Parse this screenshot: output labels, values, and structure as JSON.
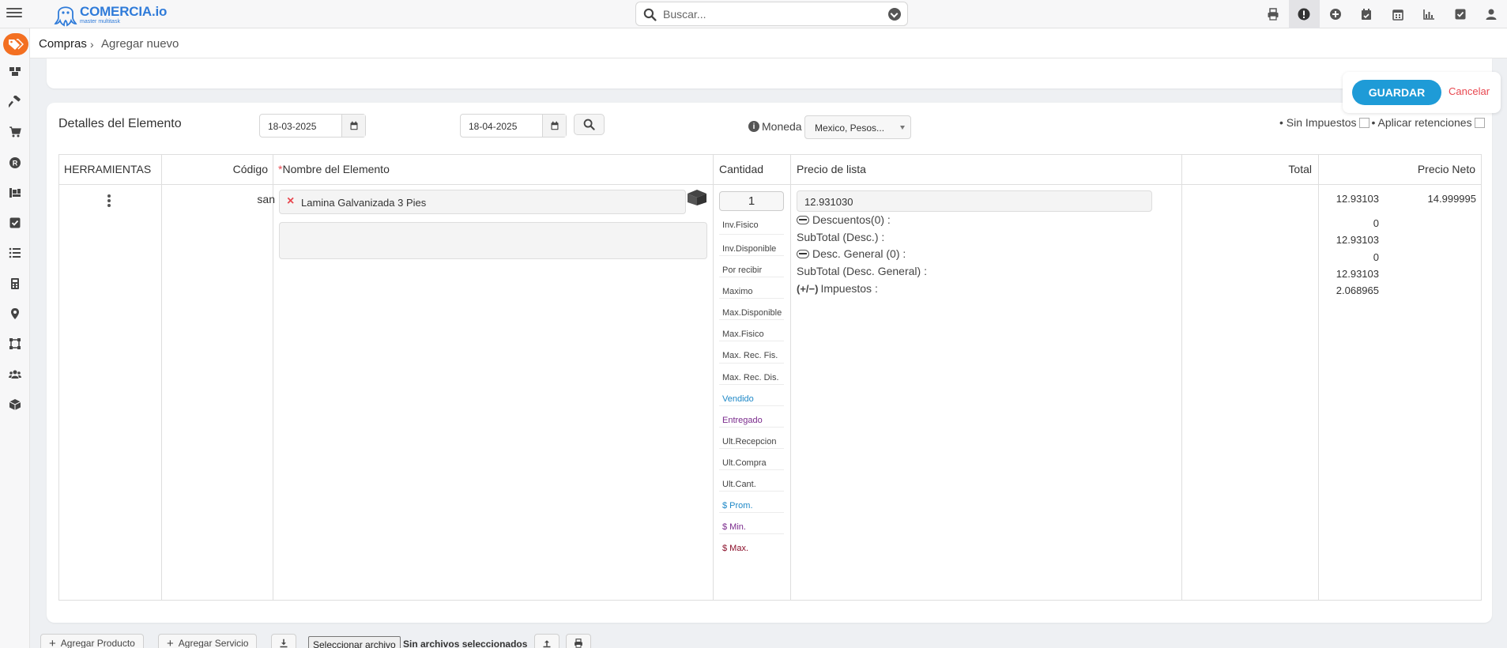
{
  "app": {
    "name": "COMERCIA.io",
    "tagline": "master multitask"
  },
  "search": {
    "placeholder": "Buscar..."
  },
  "topbar": {
    "icons": [
      "printer-icon",
      "alert-icon",
      "add-circle-icon",
      "calendar-check-icon",
      "calendar-icon",
      "bar-chart-icon",
      "check-square-icon",
      "user-icon"
    ],
    "active_icon": "alert-icon"
  },
  "sidebar": {
    "items": [
      "tags-icon",
      "boxes-icon",
      "hammer-icon",
      "cart-icon",
      "registered-icon",
      "dolly-icon",
      "check-square-icon",
      "list-icon",
      "calculator-icon",
      "map-marker-icon",
      "vector-square-icon",
      "users-icon",
      "cube-icon"
    ]
  },
  "breadcrumb": {
    "root": "Compras",
    "current": "Agregar nuevo"
  },
  "actions": {
    "save": "GUARDAR",
    "cancel": "Cancelar"
  },
  "details": {
    "title": "Detalles del Elemento",
    "date_from": "18-03-2025",
    "date_to": "18-04-2025",
    "currency_label": "Moneda",
    "currency_value": "Mexico, Pesos...",
    "sin_impuestos": "• Sin Impuestos",
    "aplicar_retenciones": "• Aplicar retenciones"
  },
  "table": {
    "headers": {
      "herramientas": "HERRAMIENTAS",
      "codigo": "Código",
      "nombre": "Nombre del Elemento",
      "cantidad": "Cantidad",
      "precio": "Precio de lista",
      "total": "Total",
      "neto": "Precio Neto"
    },
    "row": {
      "codigo": "san",
      "nombre": "Lamina Galvanizada 3 Pies",
      "cantidad": "1",
      "precio_lista": "12.931030",
      "labels": {
        "descuentos": "Descuentos(0) :",
        "subtotal_desc": "SubTotal (Desc.) :",
        "desc_general": "Desc. General (0) :",
        "subtotal_general": "SubTotal (Desc. General) :",
        "impuestos": "Impuestos :",
        "impuestos_prefix": "(+/−)"
      },
      "totals": {
        "total": "12.93103",
        "descuentos": "0",
        "subtotal_desc": "12.93103",
        "desc_general": "0",
        "subtotal_general": "12.93103",
        "impuestos": "2.068965"
      },
      "precio_neto": "14.999995"
    },
    "stats": [
      {
        "label": "Inv.Fisico",
        "color": "#444444"
      },
      {
        "label": "Inv.Disponible",
        "color": "#444444"
      },
      {
        "label": "Por recibir",
        "color": "#444444"
      },
      {
        "label": "Maximo",
        "color": "#444444"
      },
      {
        "label": "Max.Disponible",
        "color": "#444444"
      },
      {
        "label": "Max.Fisico",
        "color": "#444444"
      },
      {
        "label": "Max. Rec. Fis.",
        "color": "#444444"
      },
      {
        "label": "Max. Rec. Dis.",
        "color": "#444444"
      },
      {
        "label": "Vendido",
        "color": "#1e88c7"
      },
      {
        "label": "Entregado",
        "color": "#7a2a8c"
      },
      {
        "label": "Ult.Recepcion",
        "color": "#444444"
      },
      {
        "label": "Ult.Compra",
        "color": "#444444"
      },
      {
        "label": "Ult.Cant.",
        "color": "#444444"
      },
      {
        "label": "$ Prom.",
        "color": "#1e88c7"
      },
      {
        "label": "$ Min.",
        "color": "#7a2a8c"
      },
      {
        "label": "$ Max.",
        "color": "#8b0f2a"
      }
    ]
  },
  "bottom": {
    "add_product": "Agregar Producto",
    "add_service": "Agregar Servicio",
    "file_button": "Seleccionar archivo",
    "file_none": "Sin archivos seleccionados"
  },
  "colors": {
    "accent": "#1e9bd7",
    "brand": "#2f7bd9",
    "sidebar_active": "#f36f21",
    "cancel": "#e8474f"
  }
}
